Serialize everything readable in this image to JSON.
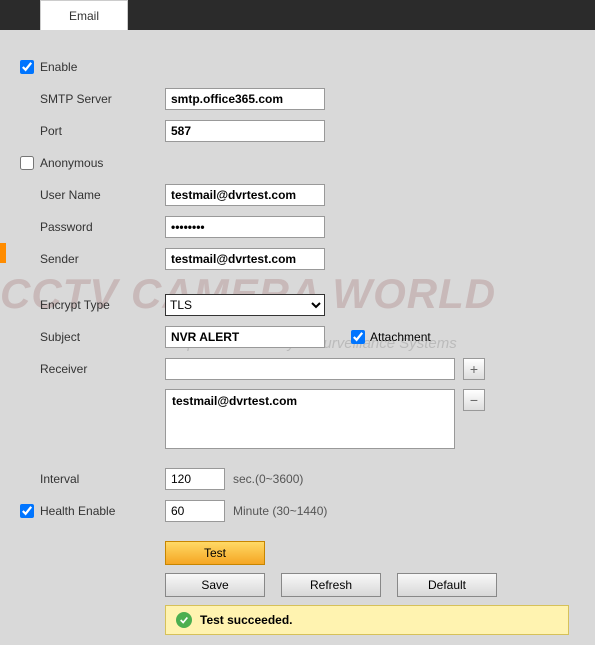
{
  "tab": {
    "label": "Email"
  },
  "form": {
    "enable_label": "Enable",
    "enable_checked": true,
    "smtp_label": "SMTP Server",
    "smtp_value": "smtp.office365.com",
    "port_label": "Port",
    "port_value": "587",
    "anonymous_label": "Anonymous",
    "anonymous_checked": false,
    "username_label": "User Name",
    "username_value": "testmail@dvrtest.com",
    "password_label": "Password",
    "password_value": "••••••••",
    "sender_label": "Sender",
    "sender_value": "testmail@dvrtest.com",
    "encrypt_label": "Encrypt Type",
    "encrypt_value": "TLS",
    "subject_label": "Subject",
    "subject_value": "NVR ALERT",
    "attachment_label": "Attachment",
    "attachment_checked": true,
    "receiver_label": "Receiver",
    "receiver_list_value": "testmail@dvrtest.com",
    "add_btn": "+",
    "remove_btn": "−",
    "interval_label": "Interval",
    "interval_value": "120",
    "interval_hint": "sec.(0~3600)",
    "health_label": "Health Enable",
    "health_checked": true,
    "health_value": "60",
    "health_hint": "Minute (30~1440)"
  },
  "buttons": {
    "test": "Test",
    "save": "Save",
    "refresh": "Refresh",
    "default": "Default"
  },
  "status": {
    "text": "Test succeeded."
  },
  "watermark": {
    "main": "CCTV CAMERA WORLD",
    "sub": "Experts in Security & Surveillance Systems"
  }
}
